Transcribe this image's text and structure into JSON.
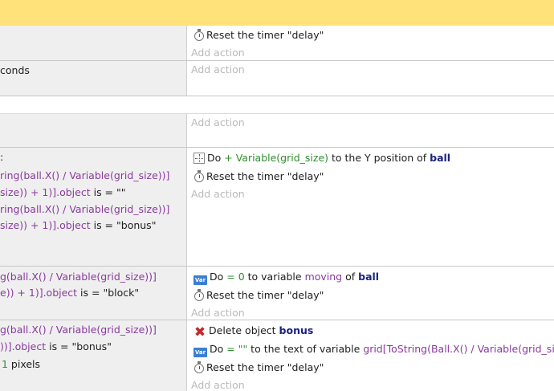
{
  "rows": [
    {
      "conditions": [],
      "actions": [
        {
          "parts": [
            {
              "t": "Reset the timer \"delay\""
            }
          ],
          "icon": "timer-icon"
        }
      ],
      "add_action": "Add action"
    },
    {
      "conditions": [
        [
          {
            "t": "conds"
          }
        ]
      ],
      "actions": [],
      "add_action": "Add action"
    },
    {
      "conditions": [],
      "actions": [],
      "add_action": "Add action"
    },
    {
      "conditions": [
        [
          {
            "t": ":"
          }
        ],
        [
          {
            "t": "ring(ball.X() / Variable(grid_size))]",
            "c": "purple"
          }
        ],
        [
          {
            "t": "size)) + 1)].object",
            "c": "purple"
          },
          {
            "t": " is = \"\""
          }
        ],
        [
          {
            "t": "ring(ball.X() / Variable(grid_size))]",
            "c": "purple"
          }
        ],
        [
          {
            "t": "size)) + 1)].object",
            "c": "purple"
          },
          {
            "t": " is = \"bonus\""
          }
        ]
      ],
      "actions": [
        {
          "icon": "position-icon",
          "parts": [
            {
              "t": "Do "
            },
            {
              "t": "+ Variable(grid_size)",
              "c": "green"
            },
            {
              "t": " to the Y position of "
            },
            {
              "t": "ball",
              "c": "obj"
            }
          ]
        },
        {
          "icon": "timer-icon",
          "parts": [
            {
              "t": "Reset the timer \"delay\""
            }
          ]
        }
      ],
      "add_action": "Add action"
    },
    {
      "conditions": [
        [
          {
            "t": "g(ball.X() / Variable(grid_size))]",
            "c": "purple"
          }
        ],
        [
          {
            "t": "e)) + 1)].object",
            "c": "purple"
          },
          {
            "t": " is = \"block\""
          }
        ]
      ],
      "actions": [
        {
          "icon": "variable-icon",
          "parts": [
            {
              "t": "Do "
            },
            {
              "t": "= 0",
              "c": "green"
            },
            {
              "t": " to variable "
            },
            {
              "t": "moving",
              "c": "purple"
            },
            {
              "t": " of "
            },
            {
              "t": "ball",
              "c": "obj"
            }
          ]
        },
        {
          "icon": "timer-icon",
          "parts": [
            {
              "t": "Reset the timer \"delay\""
            }
          ]
        }
      ],
      "add_action": "Add action"
    },
    {
      "conditions": [
        [
          {
            "t": "g(ball.X() / Variable(grid_size))]",
            "c": "purple"
          }
        ],
        [
          {
            "t": "))].object",
            "c": "purple"
          },
          {
            "t": " is = \"bonus\""
          }
        ],
        [
          {
            "t": "1",
            "c": "green"
          },
          {
            "t": " pixels"
          }
        ]
      ],
      "actions": [
        {
          "icon": "delete-icon",
          "parts": [
            {
              "t": "Delete object "
            },
            {
              "t": "bonus",
              "c": "obj"
            }
          ]
        },
        {
          "icon": "variable-icon",
          "parts": [
            {
              "t": "Do "
            },
            {
              "t": "= \"\"",
              "c": "green"
            },
            {
              "t": " to the text of variable "
            },
            {
              "t": "grid[ToString(Ball.X() / Variable(grid_size",
              "c": "purple"
            }
          ]
        },
        {
          "icon": "timer-icon",
          "parts": [
            {
              "t": "Reset the timer \"delay\""
            }
          ]
        }
      ],
      "add_action": "Add action"
    }
  ],
  "icon_labels": {
    "variable-icon": "Var"
  }
}
